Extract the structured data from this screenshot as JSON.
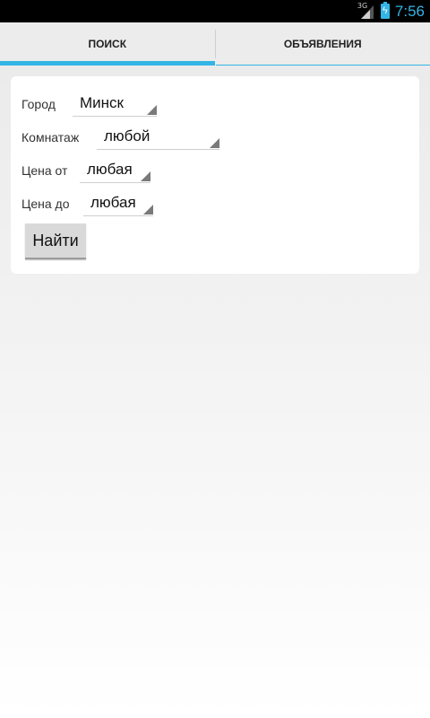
{
  "status_bar": {
    "network": "3G",
    "time": "7:56",
    "icons": [
      "signal-icon",
      "battery-charging-icon"
    ]
  },
  "tabs": [
    {
      "label": "ПОИСК",
      "active": true
    },
    {
      "label": "ОБЪЯВЛЕНИЯ",
      "active": false
    }
  ],
  "form": {
    "city": {
      "label": "Город",
      "value": "Минск"
    },
    "rooms": {
      "label": "Комнатаж",
      "value": "любой"
    },
    "price_from": {
      "label": "Цена от",
      "value": "любая"
    },
    "price_to": {
      "label": "Цена до",
      "value": "любая"
    },
    "search_button": "Найти"
  },
  "colors": {
    "accent": "#33b5e5",
    "status_bar": "#000000",
    "tab_bar": "#ececec",
    "card": "#ffffff"
  }
}
